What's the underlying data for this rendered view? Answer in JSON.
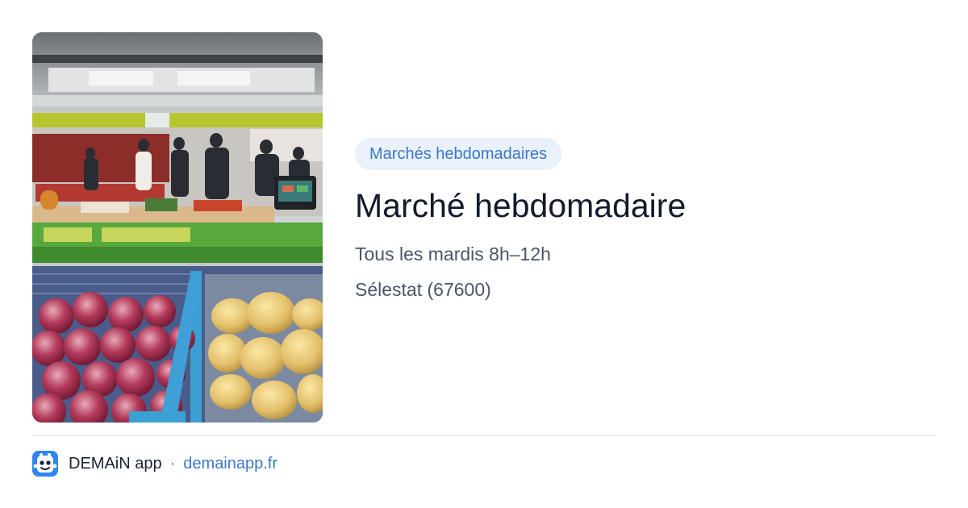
{
  "card": {
    "photo": {
      "icon": "market-stall-photo",
      "alt": ""
    },
    "category_tag": "Marchés hebdomadaires",
    "title": "Marché hebdomadaire",
    "schedule": "Tous les mardis 8h–12h",
    "location": "Sélestat (67600)"
  },
  "footer": {
    "app_icon": "demain-app-icon",
    "app_name": "DEMAiN app",
    "separator": "·",
    "site": "demainapp.fr"
  },
  "colors": {
    "accent": "#3a78c9",
    "tag_bg": "#e9f1fb",
    "title": "#121a2c",
    "meta": "#4a5567",
    "app_icon_bg": "#2f86f0"
  }
}
